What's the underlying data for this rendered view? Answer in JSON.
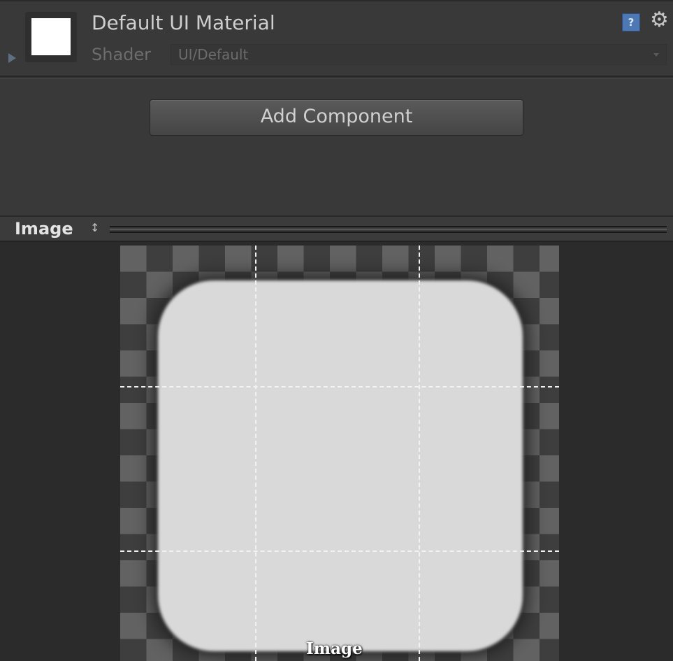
{
  "material": {
    "title": "Default UI Material",
    "shader_label": "Shader",
    "shader_value": "UI/Default",
    "help_icon": "book-help-icon",
    "settings_icon": "gear-icon"
  },
  "actions": {
    "add_component_label": "Add Component"
  },
  "preview": {
    "title": "Image",
    "caption": "Image",
    "toggle_glyph": "↕"
  },
  "colors": {
    "inspector_background": "#393939",
    "preview_background": "#2b2b2b",
    "sprite_fill": "#d9d9d9",
    "help_icon_blue": "#4d78b3"
  }
}
